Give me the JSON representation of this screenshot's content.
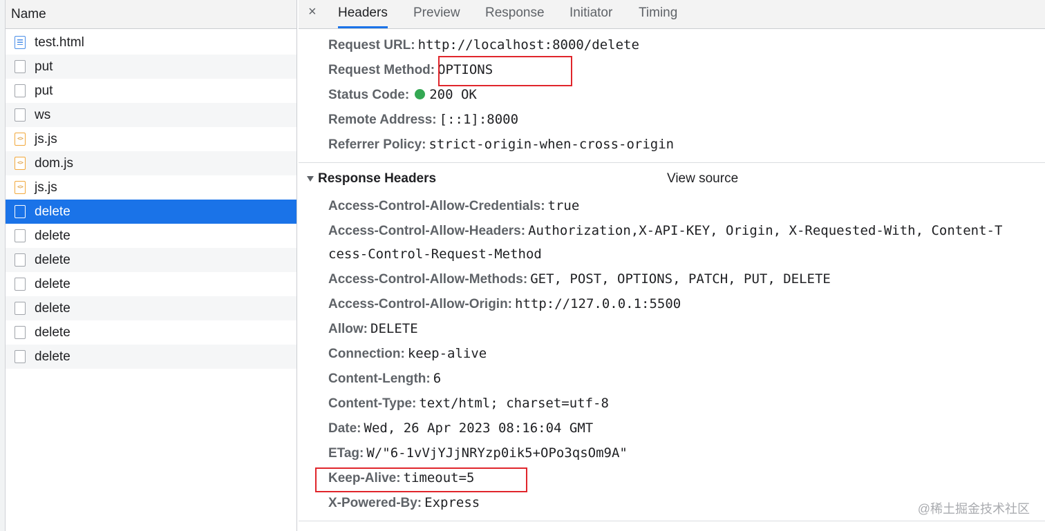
{
  "request_list": {
    "header": "Name",
    "items": [
      {
        "name": "test.html",
        "icon": "html-file-icon"
      },
      {
        "name": "put",
        "icon": "document-icon"
      },
      {
        "name": "put",
        "icon": "document-icon"
      },
      {
        "name": "ws",
        "icon": "document-icon"
      },
      {
        "name": "js.js",
        "icon": "script-file-icon"
      },
      {
        "name": "dom.js",
        "icon": "script-file-icon"
      },
      {
        "name": "js.js",
        "icon": "script-file-icon"
      },
      {
        "name": "delete",
        "icon": "document-icon",
        "selected": true
      },
      {
        "name": "delete",
        "icon": "document-icon"
      },
      {
        "name": "delete",
        "icon": "document-icon"
      },
      {
        "name": "delete",
        "icon": "document-icon"
      },
      {
        "name": "delete",
        "icon": "document-icon"
      },
      {
        "name": "delete",
        "icon": "document-icon"
      },
      {
        "name": "delete",
        "icon": "document-icon"
      }
    ]
  },
  "tabs": {
    "close": "×",
    "items": [
      "Headers",
      "Preview",
      "Response",
      "Initiator",
      "Timing"
    ],
    "active": "Headers"
  },
  "general": {
    "request_url": {
      "key": "Request URL:",
      "value": "http://localhost:8000/delete"
    },
    "request_method": {
      "key": "Request Method:",
      "value": "OPTIONS"
    },
    "status_code": {
      "key": "Status Code:",
      "value": "200 OK"
    },
    "remote_address": {
      "key": "Remote Address:",
      "value": "[::1]:8000"
    },
    "referrer_policy": {
      "key": "Referrer Policy:",
      "value": "strict-origin-when-cross-origin"
    }
  },
  "response_headers": {
    "title": "Response Headers",
    "view_source": "View source",
    "items": {
      "acac": {
        "key": "Access-Control-Allow-Credentials:",
        "value": "true"
      },
      "acah": {
        "key": "Access-Control-Allow-Headers:",
        "value": "Authorization,X-API-KEY, Origin, X-Requested-With, Content-T",
        "value_cont": "cess-Control-Request-Method"
      },
      "acam": {
        "key": "Access-Control-Allow-Methods:",
        "value": "GET, POST, OPTIONS, PATCH, PUT, DELETE"
      },
      "acao": {
        "key": "Access-Control-Allow-Origin:",
        "value": "http://127.0.0.1:5500"
      },
      "allow": {
        "key": "Allow:",
        "value": "DELETE"
      },
      "connection": {
        "key": "Connection:",
        "value": "keep-alive"
      },
      "content_length": {
        "key": "Content-Length:",
        "value": "6"
      },
      "content_type": {
        "key": "Content-Type:",
        "value": "text/html; charset=utf-8"
      },
      "date": {
        "key": "Date:",
        "value": "Wed, 26 Apr 2023 08:16:04 GMT"
      },
      "etag": {
        "key": "ETag:",
        "value": "W/\"6-1vVjYJjNRYzp0ik5+OPo3qsOm9A\""
      },
      "keep_alive": {
        "key": "Keep-Alive:",
        "value": "timeout=5"
      },
      "x_powered_by": {
        "key": "X-Powered-By:",
        "value": "Express"
      }
    }
  },
  "watermark": "@稀土掘金技术社区",
  "colors": {
    "selected_row": "#1a73e8",
    "highlight_box": "#e0252b",
    "status_ok": "#34a853"
  }
}
